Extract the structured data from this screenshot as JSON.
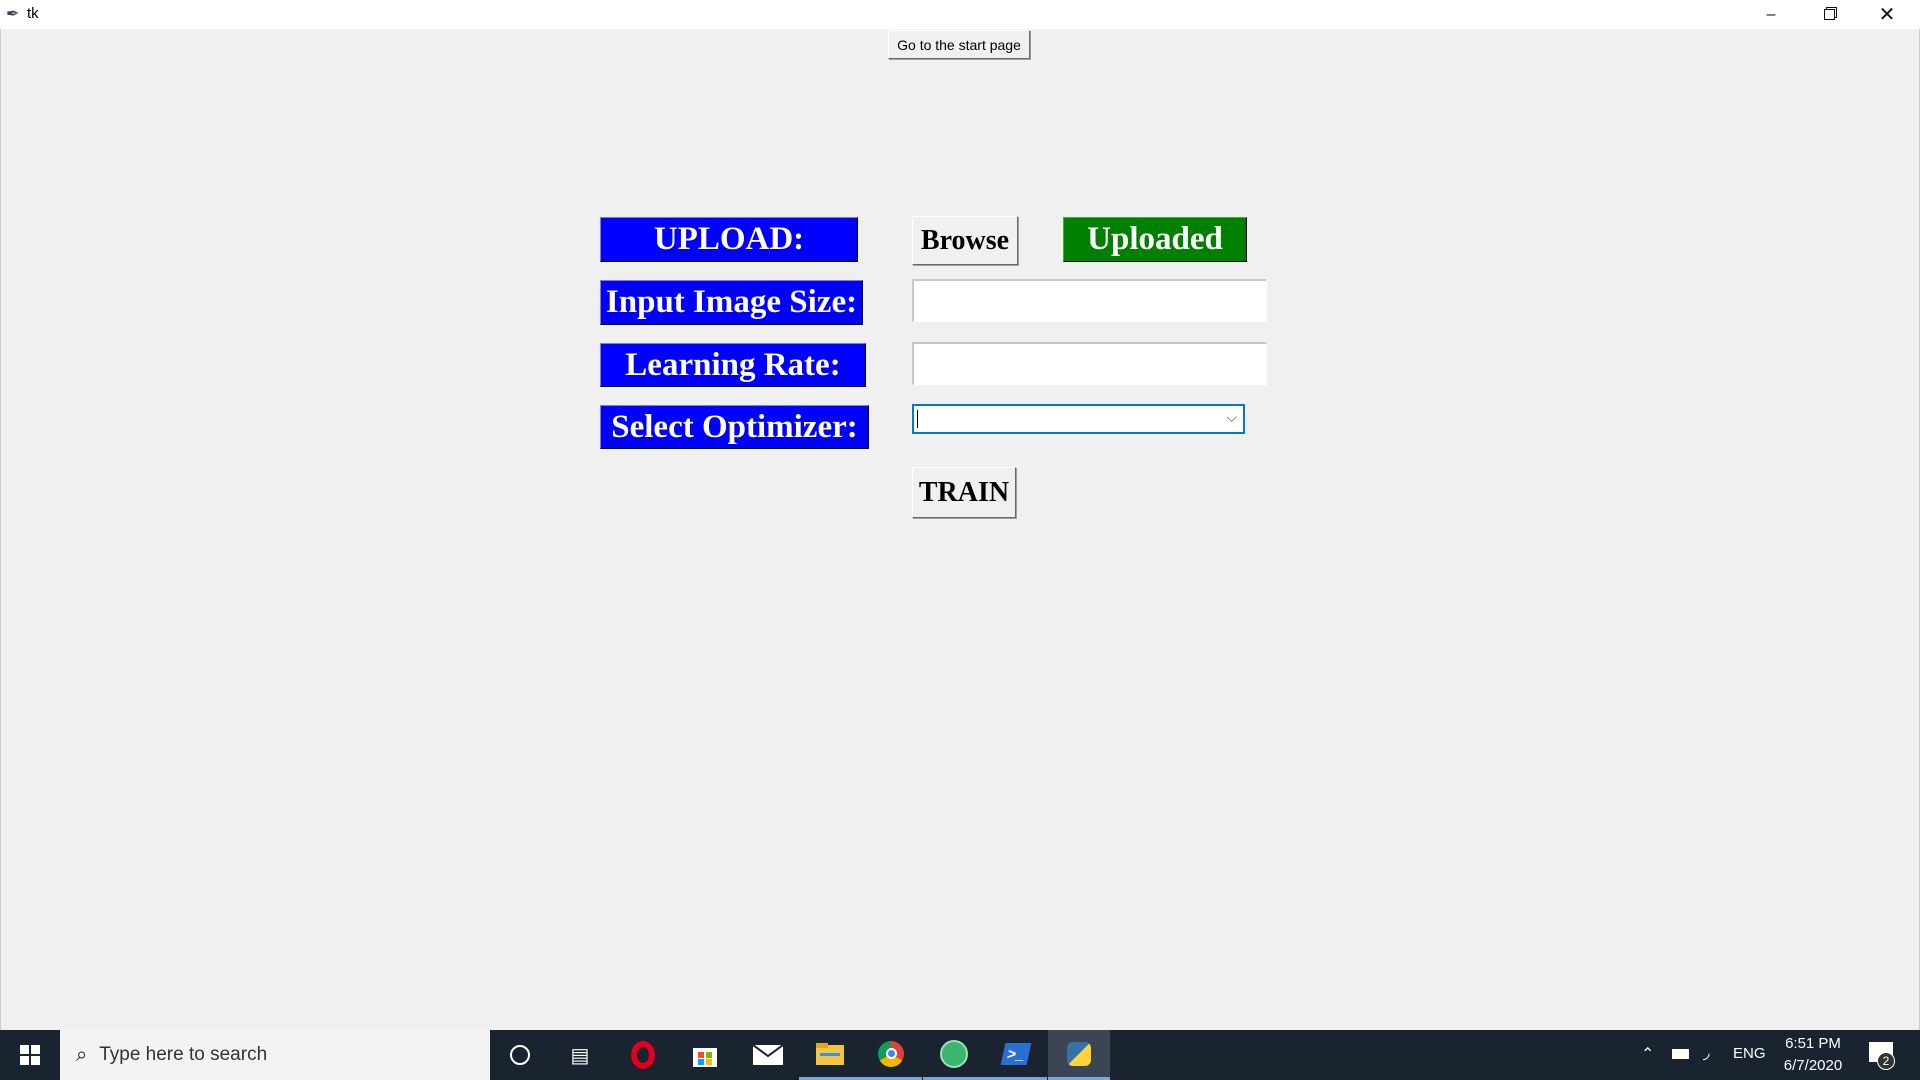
{
  "window": {
    "title": "tk",
    "icon": "tk-feather-icon",
    "controls": [
      "minimize-icon",
      "restore-icon",
      "close-icon"
    ]
  },
  "top_button": "Go to the start page",
  "form": {
    "upload_label": "UPLOAD:",
    "browse_label": "Browse",
    "uploaded_label": "Uploaded",
    "image_size_label": "Input Image Size:",
    "image_size_value": "",
    "learning_rate_label": "Learning Rate:",
    "learning_rate_value": "",
    "optimizer_label": "Select Optimizer:",
    "optimizer_value": "",
    "train_label": "TRAIN"
  },
  "colors": {
    "label_bg": "#0000ff",
    "uploaded_bg": "#008000",
    "taskbar": "#1a2330"
  },
  "taskbar": {
    "search_placeholder": "Type here to search",
    "apps": [
      "cortana-icon",
      "task-view-icon",
      "opera-icon",
      "store-icon",
      "mail-icon",
      "file-explorer-icon",
      "chrome-icon",
      "globe-app-icon",
      "powershell-icon",
      "python-icon"
    ],
    "tray": {
      "language": "ENG",
      "time": "6:51 PM",
      "date": "6/7/2020",
      "notifications": "2"
    }
  }
}
